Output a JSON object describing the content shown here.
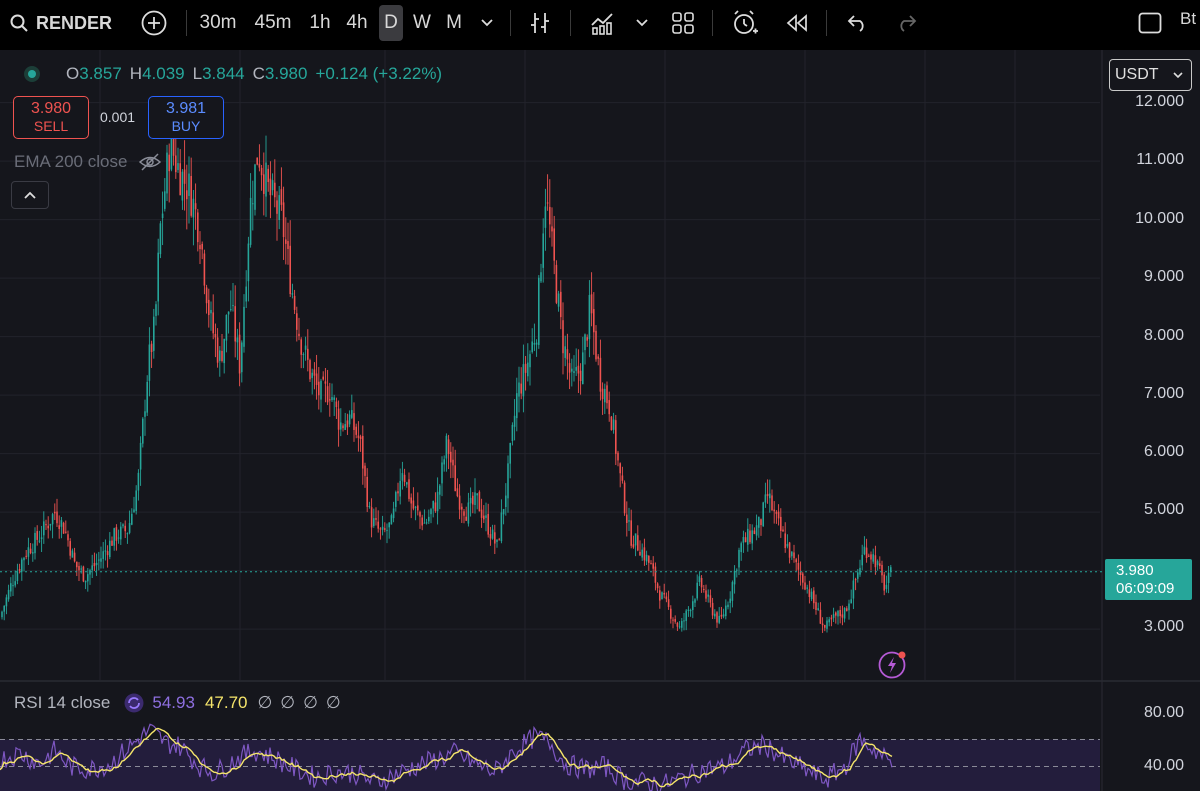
{
  "symbol": "RENDER",
  "timeframes": [
    "30m",
    "45m",
    "1h",
    "4h",
    "D",
    "W",
    "M"
  ],
  "active_timeframe": "D",
  "toolbar_right_text": "Bt",
  "ohlc": {
    "o_label": "O",
    "o": "3.857",
    "h_label": "H",
    "h": "4.039",
    "l_label": "L",
    "l": "3.844",
    "c_label": "C",
    "c": "3.980",
    "change": "+0.124 (+3.22%)"
  },
  "sell": {
    "price": "3.980",
    "label": "SELL"
  },
  "spread": "0.001",
  "buy": {
    "price": "3.981",
    "label": "BUY"
  },
  "ema_label": "EMA 200 close",
  "currency": "USDT",
  "price_axis": [
    "12.000",
    "11.000",
    "10.000",
    "9.000",
    "8.000",
    "7.000",
    "6.000",
    "5.000",
    "3.000"
  ],
  "last_price": {
    "price": "3.980",
    "countdown": "06:09:09"
  },
  "rsi": {
    "label": "RSI 14 close",
    "value": "54.93",
    "ma": "47.70",
    "empties": [
      "∅",
      "∅",
      "∅",
      "∅"
    ],
    "axis": [
      "80.00",
      "40.00"
    ]
  },
  "colors": {
    "up": "#26a69a",
    "down": "#ef5350",
    "rsi": "#7e57c2",
    "rsi_ma": "#f5e56b",
    "bg": "#15161c"
  },
  "chart_data": {
    "type": "candlestick",
    "ylim": [
      2.3,
      12.3
    ],
    "price_profile": [
      [
        0,
        3.2
      ],
      [
        12,
        3.8
      ],
      [
        25,
        4.3
      ],
      [
        40,
        4.6
      ],
      [
        55,
        5.0
      ],
      [
        65,
        4.7
      ],
      [
        75,
        4.1
      ],
      [
        85,
        3.9
      ],
      [
        100,
        4.2
      ],
      [
        115,
        4.6
      ],
      [
        128,
        4.7
      ],
      [
        138,
        5.5
      ],
      [
        148,
        7.5
      ],
      [
        155,
        8.2
      ],
      [
        160,
        9.8
      ],
      [
        170,
        11.3
      ],
      [
        180,
        10.8
      ],
      [
        190,
        10.5
      ],
      [
        200,
        9.8
      ],
      [
        210,
        8.3
      ],
      [
        220,
        7.6
      ],
      [
        230,
        8.6
      ],
      [
        240,
        7.5
      ],
      [
        250,
        10.2
      ],
      [
        258,
        11.2
      ],
      [
        268,
        10.5
      ],
      [
        282,
        10.0
      ],
      [
        292,
        8.8
      ],
      [
        300,
        8.0
      ],
      [
        310,
        7.4
      ],
      [
        320,
        7.0
      ],
      [
        330,
        7.1
      ],
      [
        340,
        6.5
      ],
      [
        350,
        6.6
      ],
      [
        360,
        6.2
      ],
      [
        370,
        4.9
      ],
      [
        382,
        4.6
      ],
      [
        392,
        4.8
      ],
      [
        402,
        5.8
      ],
      [
        412,
        5.1
      ],
      [
        425,
        4.8
      ],
      [
        437,
        5.2
      ],
      [
        447,
        6.2
      ],
      [
        457,
        5.3
      ],
      [
        467,
        5.0
      ],
      [
        477,
        5.2
      ],
      [
        487,
        4.8
      ],
      [
        497,
        4.4
      ],
      [
        507,
        5.5
      ],
      [
        517,
        7.0
      ],
      [
        527,
        7.5
      ],
      [
        537,
        8.2
      ],
      [
        545,
        10.5
      ],
      [
        552,
        9.5
      ],
      [
        562,
        8.0
      ],
      [
        572,
        7.2
      ],
      [
        582,
        7.5
      ],
      [
        590,
        8.5
      ],
      [
        600,
        7.3
      ],
      [
        610,
        6.8
      ],
      [
        620,
        5.6
      ],
      [
        630,
        4.6
      ],
      [
        640,
        4.4
      ],
      [
        650,
        4.1
      ],
      [
        660,
        3.6
      ],
      [
        670,
        3.3
      ],
      [
        680,
        3.0
      ],
      [
        690,
        3.4
      ],
      [
        700,
        3.8
      ],
      [
        710,
        3.4
      ],
      [
        720,
        3.1
      ],
      [
        730,
        3.6
      ],
      [
        740,
        4.4
      ],
      [
        750,
        4.6
      ],
      [
        760,
        4.8
      ],
      [
        768,
        5.3
      ],
      [
        775,
        4.9
      ],
      [
        785,
        4.5
      ],
      [
        795,
        4.1
      ],
      [
        805,
        3.8
      ],
      [
        815,
        3.4
      ],
      [
        825,
        3.0
      ],
      [
        835,
        3.2
      ],
      [
        845,
        3.3
      ],
      [
        855,
        3.8
      ],
      [
        865,
        4.4
      ],
      [
        875,
        4.2
      ],
      [
        885,
        3.7
      ],
      [
        892,
        3.98
      ]
    ],
    "rsi_profile": [
      [
        0,
        55
      ],
      [
        20,
        60
      ],
      [
        40,
        52
      ],
      [
        55,
        62
      ],
      [
        70,
        50
      ],
      [
        90,
        48
      ],
      [
        110,
        52
      ],
      [
        135,
        68
      ],
      [
        150,
        77
      ],
      [
        165,
        68
      ],
      [
        180,
        65
      ],
      [
        200,
        50
      ],
      [
        215,
        45
      ],
      [
        235,
        55
      ],
      [
        255,
        62
      ],
      [
        275,
        56
      ],
      [
        295,
        48
      ],
      [
        315,
        42
      ],
      [
        335,
        46
      ],
      [
        355,
        45
      ],
      [
        375,
        38
      ],
      [
        395,
        44
      ],
      [
        415,
        50
      ],
      [
        435,
        55
      ],
      [
        455,
        60
      ],
      [
        475,
        52
      ],
      [
        495,
        46
      ],
      [
        515,
        62
      ],
      [
        535,
        72
      ],
      [
        550,
        68
      ],
      [
        565,
        52
      ],
      [
        585,
        48
      ],
      [
        605,
        50
      ],
      [
        625,
        40
      ],
      [
        645,
        38
      ],
      [
        665,
        37
      ],
      [
        685,
        42
      ],
      [
        705,
        48
      ],
      [
        725,
        50
      ],
      [
        745,
        62
      ],
      [
        765,
        66
      ],
      [
        785,
        55
      ],
      [
        805,
        48
      ],
      [
        825,
        40
      ],
      [
        845,
        50
      ],
      [
        860,
        70
      ],
      [
        875,
        62
      ],
      [
        892,
        52
      ]
    ]
  }
}
